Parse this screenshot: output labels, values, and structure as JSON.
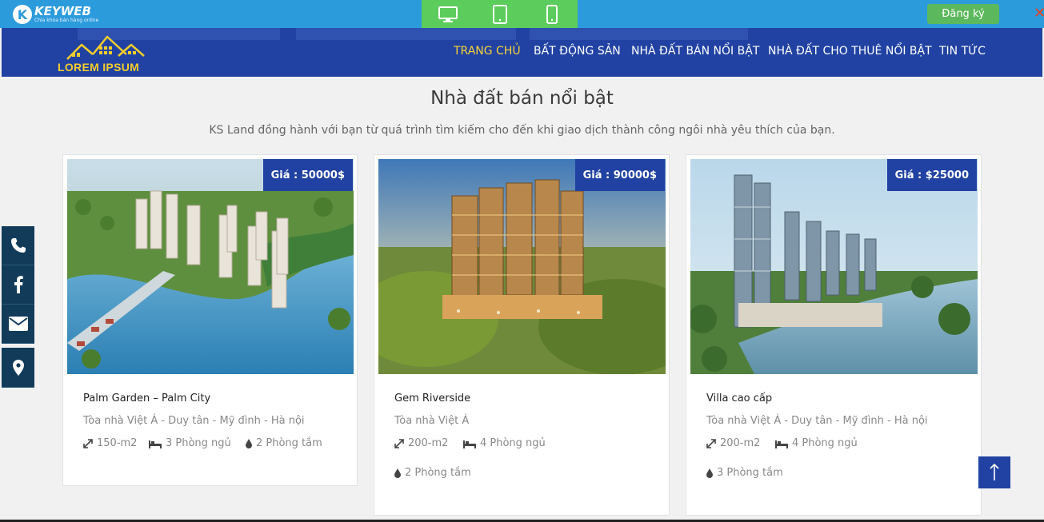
{
  "toolbar": {
    "brand_name": "KEYWEB",
    "brand_mark": "K",
    "brand_tagline": "Chìa khóa bán hàng online",
    "devices": [
      {
        "name": "desktop-icon"
      },
      {
        "name": "tablet-icon"
      },
      {
        "name": "mobile-icon"
      }
    ],
    "register_label": "Đăng ký",
    "close_symbol": "✕",
    "colors": {
      "bar": "#2c9bdc",
      "devices_bg": "#5ccc5c",
      "register": "#5cb85c"
    }
  },
  "header": {
    "logo_text": "LOREM IPSUM",
    "nav": [
      {
        "label": "TRANG CHỦ",
        "active": true
      },
      {
        "label": "BẤT ĐỘNG SẢN",
        "active": false
      },
      {
        "label": "NHÀ ĐẤT BÁN NỔI BẬT",
        "active": false
      },
      {
        "label": "NHÀ ĐẤT CHO THUÊ NỔI BẬT",
        "active": false
      },
      {
        "label": "TIN TỨC",
        "active": false
      }
    ],
    "colors": {
      "bg": "#2142a2",
      "active": "#f6d23a"
    }
  },
  "section": {
    "title": "Nhà đất bán nổi bật",
    "subtitle": "KS Land đồng hành với bạn từ quá trình tìm kiếm cho đến khi giao dịch thành công ngôi nhà yêu thích của bạn."
  },
  "listings": [
    {
      "price": "Giá :  50000$",
      "title": "Palm Garden – Palm City",
      "address": "Tòa nhà Việt Á - Duy tân - Mỹ đình - Hà nội",
      "area": "150-m2",
      "bedrooms": "3 Phòng ngủ",
      "bathrooms": "2 Phòng tắm"
    },
    {
      "price": "Giá :  90000$",
      "title": "Gem Riverside",
      "address": "Tòa nhà Việt Á",
      "area": "200-m2",
      "bedrooms": "4 Phòng ngủ",
      "bathrooms": "2 Phòng tắm"
    },
    {
      "price": "Giá :  $25000",
      "title": "Villa cao cấp",
      "address": "Tòa nhà Việt Á - Duy tân - Mỹ đình - Hà nội",
      "area": "200-m2",
      "bedrooms": "4 Phòng ngủ",
      "bathrooms": "3 Phòng tắm"
    }
  ],
  "social": [
    {
      "name": "phone-icon"
    },
    {
      "name": "facebook-icon"
    },
    {
      "name": "email-icon"
    },
    {
      "name": "map-marker-icon"
    }
  ],
  "back_to_top": {
    "icon": "arrow-up-icon"
  }
}
